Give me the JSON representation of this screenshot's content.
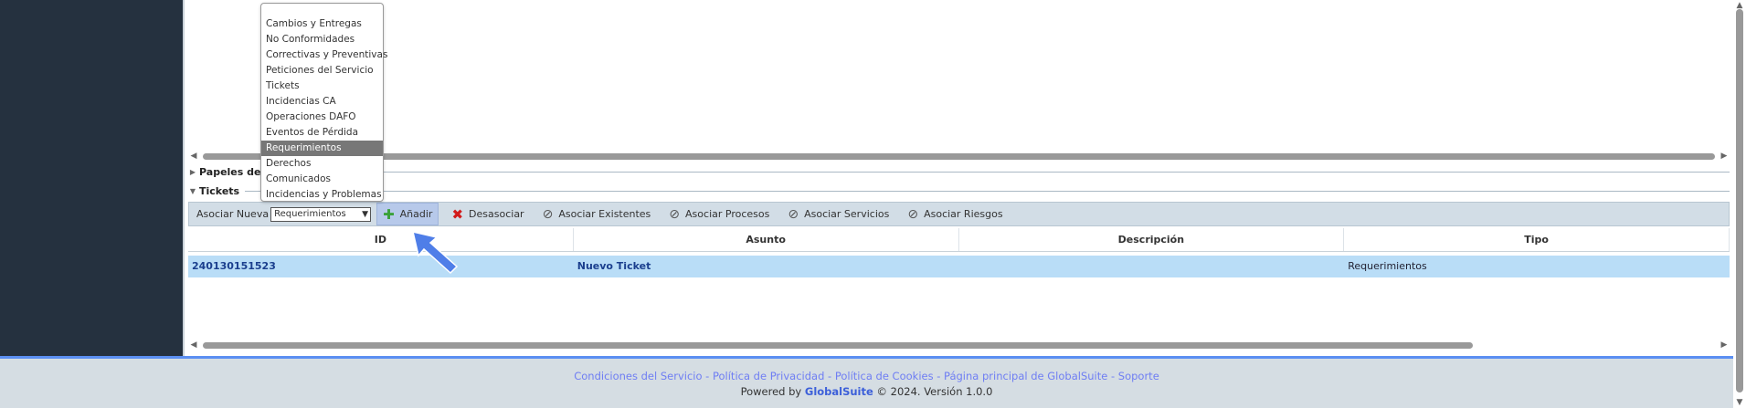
{
  "sections": {
    "papeles": "Papeles de T",
    "tickets": "Tickets"
  },
  "toolbar": {
    "associate_new_label": "Asociar Nueva",
    "select_value": "Requerimientos",
    "add_label": "Añadir",
    "disassociate_label": "Desasociar",
    "associate_existing_label": "Asociar Existentes",
    "associate_processes_label": "Asociar Procesos",
    "associate_services_label": "Asociar Servicios",
    "associate_risks_label": "Asociar Riesgos"
  },
  "dropdown": {
    "options": [
      "Cambios y Entregas",
      "No Conformidades",
      "Correctivas y Preventivas",
      "Peticiones del Servicio",
      "Tickets",
      "Incidencias CA",
      "Operaciones DAFO",
      "Eventos de Pérdida",
      "Requerimientos",
      "Derechos",
      "Comunicados",
      "Incidencias y Problemas"
    ],
    "selected_index": 8
  },
  "grid": {
    "columns": [
      "ID",
      "Asunto",
      "Descripción",
      "Tipo"
    ],
    "rows": [
      {
        "id": "240130151523",
        "asunto": "Nuevo Ticket",
        "descripcion": "",
        "tipo": "Requerimientos"
      }
    ]
  },
  "footer": {
    "link_service": "Condiciones del Servicio",
    "link_privacy": "Política de Privacidad",
    "link_cookies": "Política de Cookies",
    "link_home": "Página principal de GlobalSuite",
    "link_support": "Soporte",
    "separator": " - ",
    "powered_by": "Powered by",
    "brand": "GlobalSuite",
    "copyright": "© 2024.  Versión 1.0.0"
  },
  "colors": {
    "sidebar": "#25313f",
    "toolbar": "#d2dde6",
    "row_selected": "#b9ddf7",
    "footer_link": "#6f7ef3",
    "footer_border": "#5b8ff2",
    "pointer": "#4f7ee8"
  }
}
